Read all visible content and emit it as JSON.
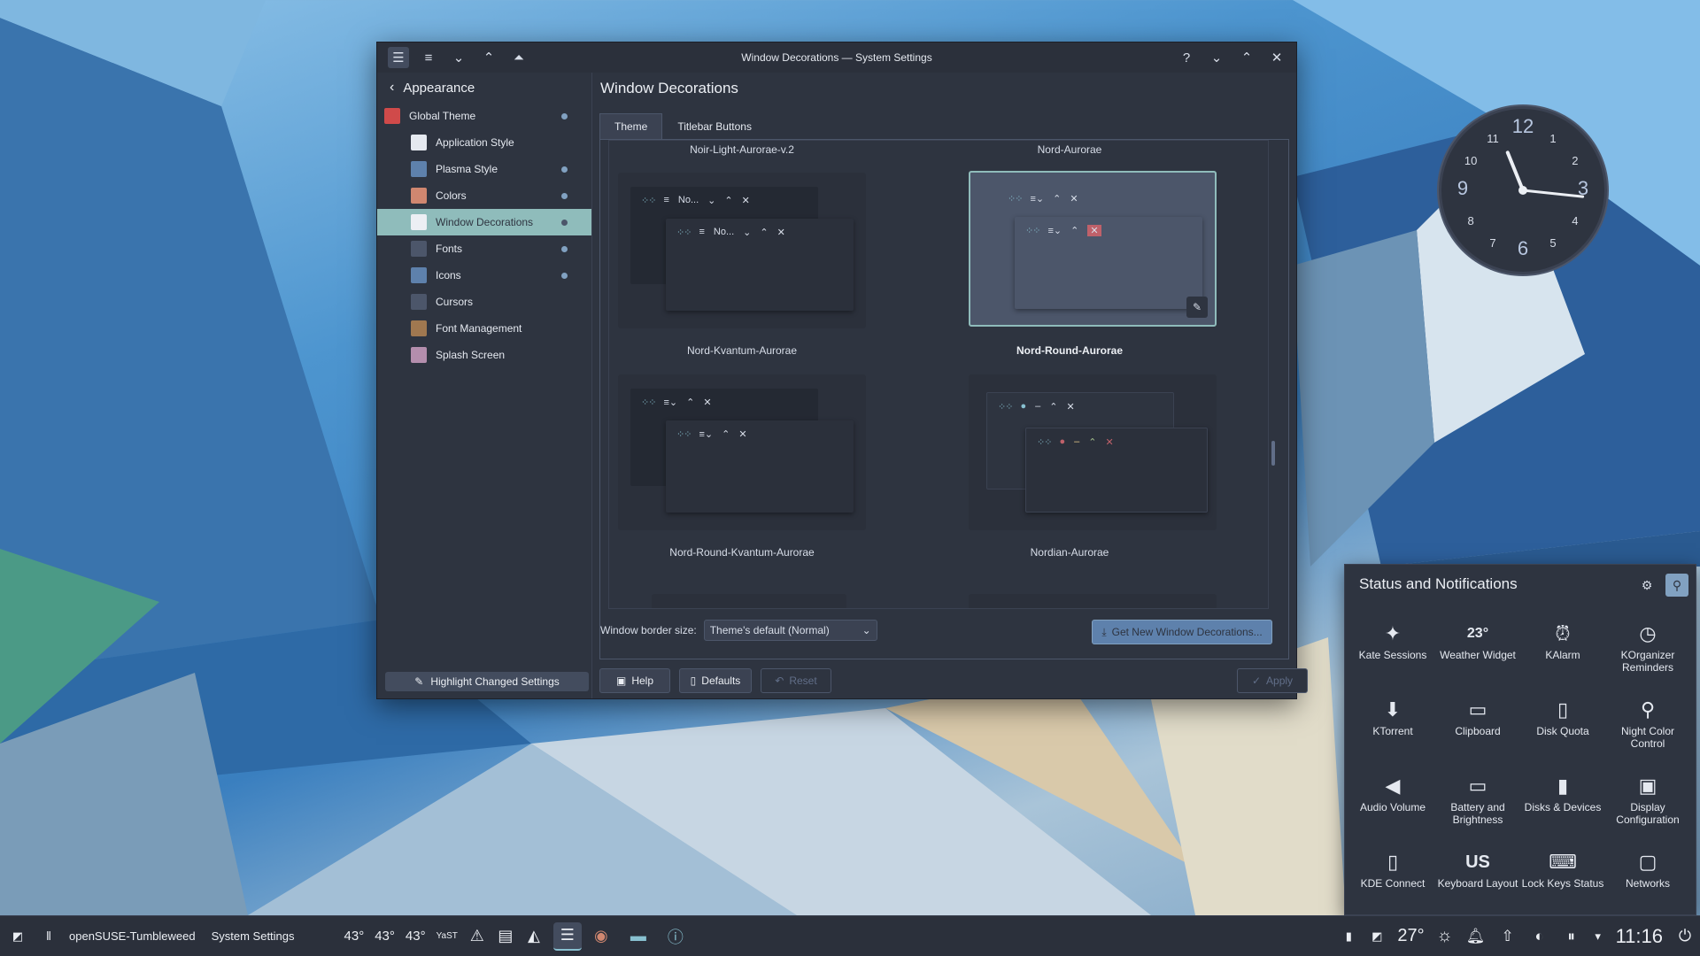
{
  "window": {
    "title": "Window Decorations — System Settings",
    "help_icon": "?",
    "sidebar": {
      "back_label": "Appearance",
      "items": [
        {
          "label": "Global Theme",
          "icon": "global-theme-icon",
          "changed": true,
          "color": "#d04a4a"
        },
        {
          "label": "Application Style",
          "icon": "application-style-icon",
          "changed": false,
          "color": "#e5e9f0"
        },
        {
          "label": "Plasma Style",
          "icon": "plasma-style-icon",
          "changed": true,
          "color": "#5e81ac"
        },
        {
          "label": "Colors",
          "icon": "colors-icon",
          "changed": true,
          "color": "#d08770"
        },
        {
          "label": "Window Decorations",
          "icon": "window-decorations-icon",
          "changed": true,
          "selected": true,
          "color": "#eceff4"
        },
        {
          "label": "Fonts",
          "icon": "fonts-icon",
          "changed": true,
          "color": "#4c566a"
        },
        {
          "label": "Icons",
          "icon": "icons-icon",
          "changed": true,
          "color": "#5e81ac"
        },
        {
          "label": "Cursors",
          "icon": "cursors-icon",
          "changed": false,
          "color": "#4c566a"
        },
        {
          "label": "Font Management",
          "icon": "font-management-icon",
          "changed": false,
          "color": "#a07850"
        },
        {
          "label": "Splash Screen",
          "icon": "splash-screen-icon",
          "changed": false,
          "color": "#b48ead"
        }
      ],
      "highlight_button": "Highlight Changed Settings"
    },
    "main": {
      "title": "Window Decorations",
      "tabs": [
        {
          "label": "Theme",
          "selected": true
        },
        {
          "label": "Titlebar Buttons",
          "selected": false
        }
      ],
      "top_labels": [
        "Noir-Light-Aurorae-v.2",
        "Nord-Aurorae"
      ],
      "themes": [
        {
          "name": "Nord-Kvantum-Aurorae",
          "mini_title": "No...",
          "selected": false
        },
        {
          "name": "Nord-Round-Aurorae",
          "mini_title": "",
          "selected": true
        },
        {
          "name": "Nord-Round-Kvantum-Aurorae",
          "mini_title": "",
          "selected": false
        },
        {
          "name": "Nordian-Aurorae",
          "mini_title": "",
          "selected": false
        }
      ],
      "border_size_label": "Window border size:",
      "border_size_value": "Theme's default (Normal)",
      "get_new_label": "Get New Window Decorations...",
      "buttons": {
        "help": "Help",
        "defaults": "Defaults",
        "reset": "Reset",
        "apply": "Apply"
      }
    }
  },
  "clock": {
    "numbers": [
      "12",
      "1",
      "2",
      "3",
      "4",
      "5",
      "6",
      "7",
      "8",
      "9",
      "10",
      "11"
    ],
    "time": "11:16"
  },
  "notifications": {
    "title": "Status and Notifications",
    "items": [
      {
        "label": "Kate Sessions",
        "icon": "kate-icon"
      },
      {
        "label": "Weather Widget",
        "icon": "weather-cloud-icon",
        "value": "23°"
      },
      {
        "label": "KAlarm",
        "icon": "alarm-clock-icon"
      },
      {
        "label": "KOrganizer Reminders",
        "icon": "clock-icon"
      },
      {
        "label": "KTorrent",
        "icon": "ktorrent-icon"
      },
      {
        "label": "Clipboard",
        "icon": "clipboard-icon"
      },
      {
        "label": "Disk Quota",
        "icon": "disk-quota-icon"
      },
      {
        "label": "Night Color Control",
        "icon": "night-color-icon"
      },
      {
        "label": "Audio Volume",
        "icon": "speaker-icon"
      },
      {
        "label": "Battery and Brightness",
        "icon": "battery-icon"
      },
      {
        "label": "Disks & Devices",
        "icon": "usb-drive-icon"
      },
      {
        "label": "Display Configuration",
        "icon": "display-icon"
      },
      {
        "label": "KDE Connect",
        "icon": "phone-icon"
      },
      {
        "label": "Keyboard Layout",
        "icon": "keyboard-layout-icon",
        "value": "US"
      },
      {
        "label": "Lock Keys Status",
        "icon": "keyboard-icon"
      },
      {
        "label": "Networks",
        "icon": "network-icon"
      }
    ]
  },
  "taskbar": {
    "activity": "openSUSE-Tumbleweed",
    "app_name": "System Settings",
    "temps": [
      "43°",
      "43°",
      "43°"
    ],
    "yast_label": "YaST",
    "weather_temp": "27°",
    "clock": "11:16"
  }
}
